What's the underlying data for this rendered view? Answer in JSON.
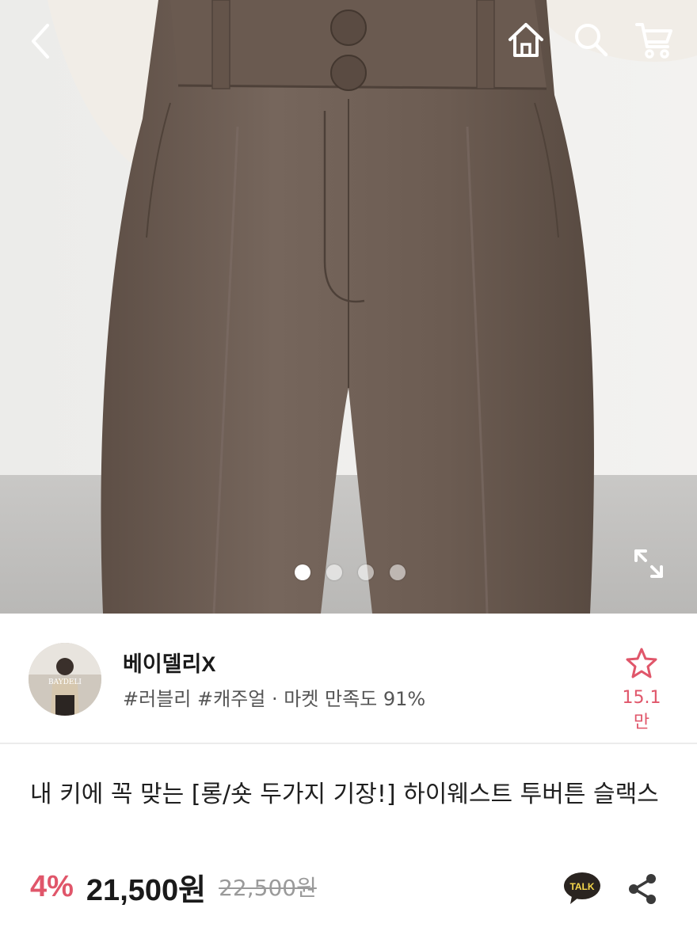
{
  "header": {
    "icons": [
      "back-arrow-icon",
      "home-icon",
      "search-icon",
      "cart-icon"
    ]
  },
  "gallery": {
    "slide_count": 4,
    "active_index": 0,
    "icons": [
      "expand-icon"
    ]
  },
  "shop": {
    "name": "베이델리X",
    "tags": "#러블리 #캐주얼 · 마켓 만족도 91%",
    "favorite_count": "15.1만",
    "icons": [
      "star-icon"
    ],
    "avatar_text": "BAYDELI"
  },
  "product": {
    "title": "내 키에 꼭 맞는 [롱/숏 두가지 기장!] 하이웨스트 투버튼 슬랙스",
    "discount": "4%",
    "price": "21,500원",
    "original_price": "22,500원",
    "icons": [
      "kakaotalk-icon",
      "share-icon"
    ]
  },
  "colors": {
    "accent": "#e0566a",
    "pants": "#6e5e54",
    "text": "#1f1f1f",
    "muted": "#9a9a9a"
  }
}
